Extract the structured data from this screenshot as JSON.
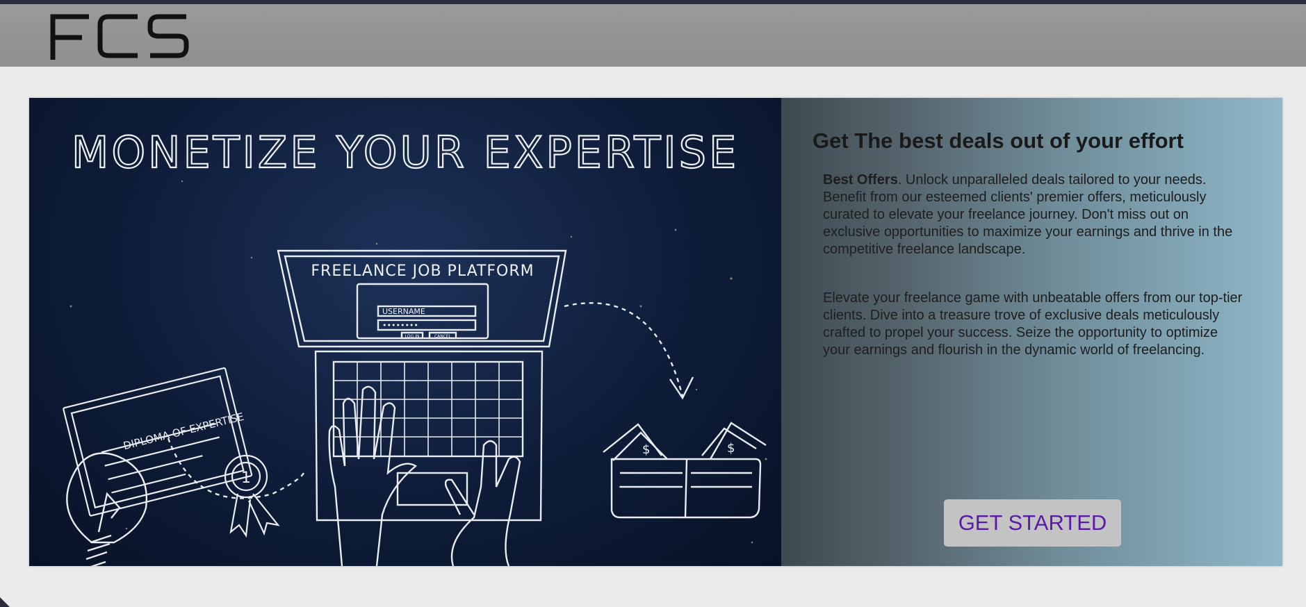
{
  "brand": {
    "logo_text": "FCS",
    "colors": {
      "topbar": "#2a2d3e",
      "navbar": "#959595",
      "cta_text": "#5a1aa8"
    }
  },
  "hero": {
    "headline": "MONETIZE YOUR EXPERTISE",
    "diploma_label": "DIPLOMA OF EXPERTISE",
    "diploma_badge": "1",
    "laptop_title": "FREELANCE JOB PLATFORM",
    "username_label": "USERNAME",
    "password_mask": "••••••••",
    "login_button": "LOG IN",
    "cancel_button": "CANCEL"
  },
  "panel": {
    "title": "Get The best deals out of your effort",
    "p1_bold": "Best Offers",
    "p1_text": ". Unlock unparalleled deals tailored to your needs. Benefit from our esteemed clients' premier offers, meticulously curated to elevate your freelance journey. Don't miss out on exclusive opportunities to maximize your earnings and thrive in the competitive freelance landscape.",
    "p2_text": "Elevate your freelance game with unbeatable offers from our top-tier clients. Dive into a treasure trove of exclusive deals meticulously crafted to propel your success. Seize the opportunity to optimize your earnings and flourish in the dynamic world of freelancing.",
    "cta_label": "GET STARTED"
  }
}
